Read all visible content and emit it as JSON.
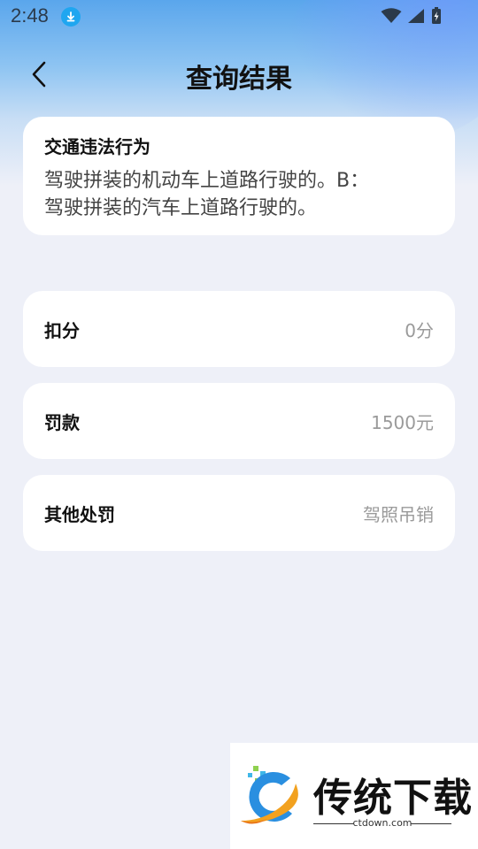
{
  "status_bar": {
    "time": "2:48"
  },
  "header": {
    "title": "查询结果"
  },
  "violation": {
    "label": "交通违法行为",
    "line1": "驾驶拼装的机动车上道路行驶的。B：",
    "line2": "驾驶拼装的汽车上道路行驶的。"
  },
  "rows": [
    {
      "label": "扣分",
      "value": "0分"
    },
    {
      "label": "罚款",
      "value": "1500元"
    },
    {
      "label": "其他处罚",
      "value": "驾照吊销"
    }
  ],
  "watermark": {
    "title": "传统下载",
    "url": "ctdown.com"
  },
  "colors": {
    "accent": "#1fa6f0",
    "background": "#eef0f8",
    "card": "#ffffff"
  }
}
